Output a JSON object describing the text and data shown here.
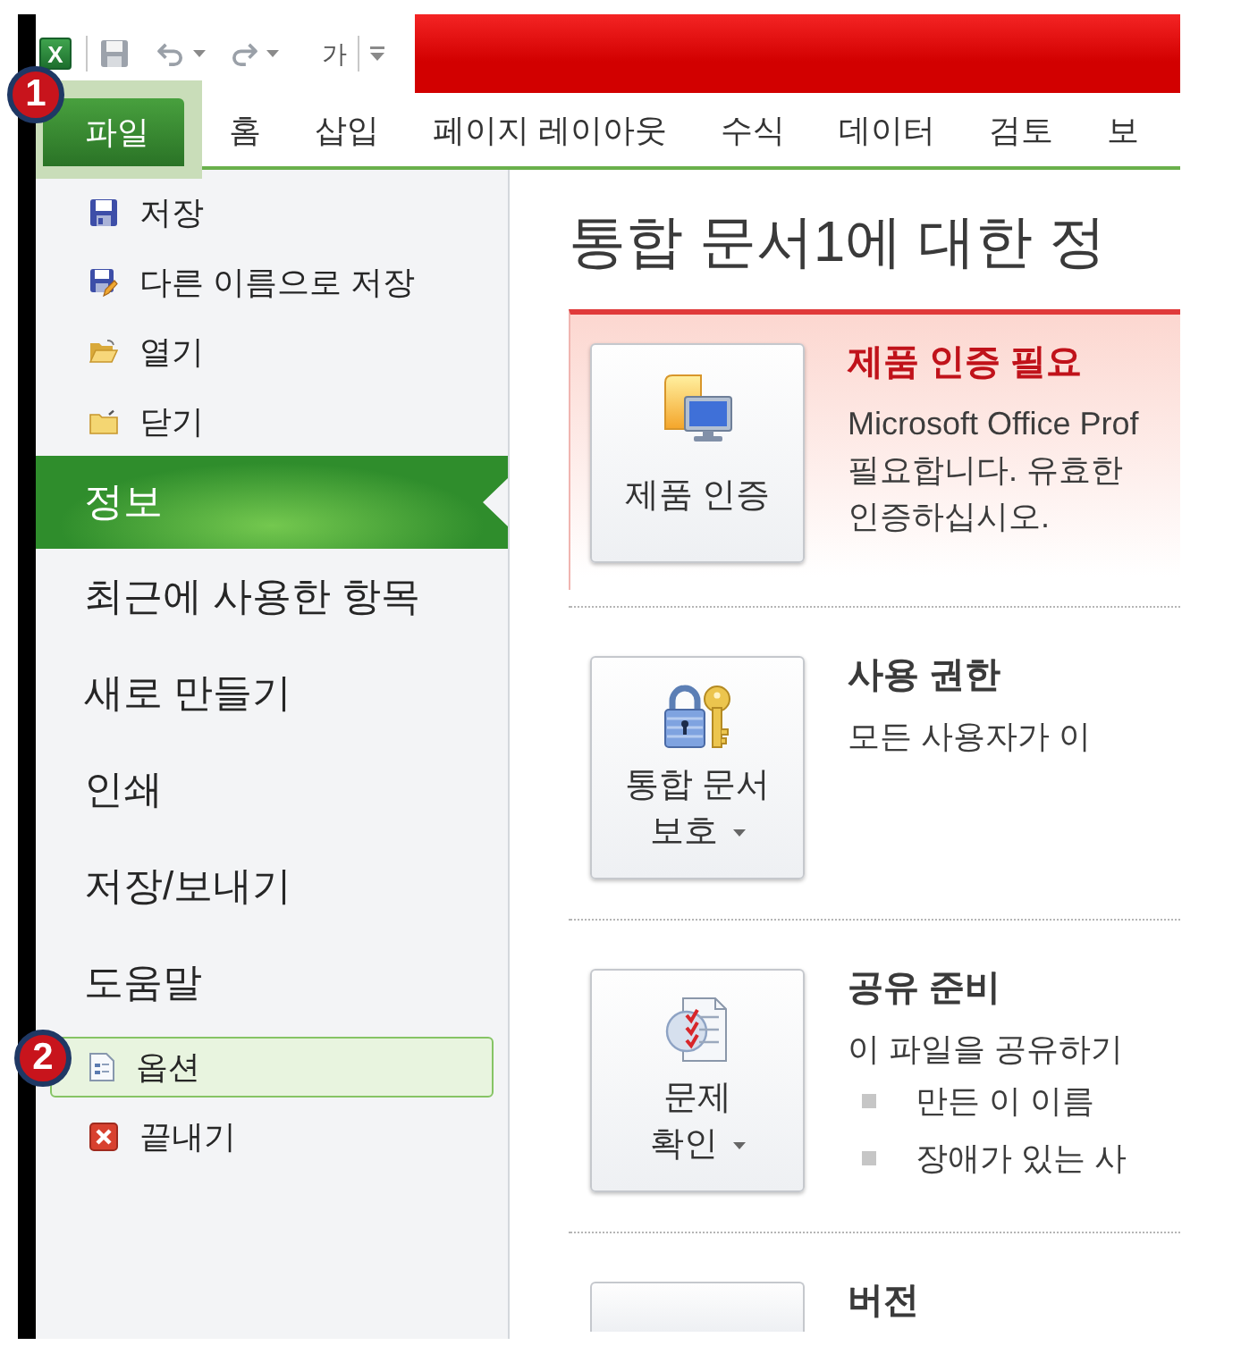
{
  "quick_access_toolbar": {
    "app_logo": "X",
    "font_button": "가"
  },
  "ribbon_tabs": [
    {
      "label": "파일",
      "kind": "file",
      "selected": true,
      "highlighted": true,
      "callout": "1"
    },
    {
      "label": "홈",
      "kind": "tab",
      "selected": false,
      "highlighted": false
    },
    {
      "label": "삽입",
      "kind": "tab",
      "selected": false,
      "highlighted": false
    },
    {
      "label": "페이지 레이아웃",
      "kind": "tab",
      "selected": false,
      "highlighted": false
    },
    {
      "label": "수식",
      "kind": "tab",
      "selected": false,
      "highlighted": false
    },
    {
      "label": "데이터",
      "kind": "tab",
      "selected": false,
      "highlighted": false
    },
    {
      "label": "검토",
      "kind": "tab",
      "selected": false,
      "highlighted": false
    },
    {
      "label": "보",
      "kind": "tab",
      "selected": false,
      "highlighted": false
    }
  ],
  "backstage_menu": [
    {
      "label": "저장",
      "kind": "command",
      "selected": false,
      "highlighted": false
    },
    {
      "label": "다른 이름으로 저장",
      "kind": "command",
      "selected": false,
      "highlighted": false
    },
    {
      "label": "열기",
      "kind": "command",
      "selected": false,
      "highlighted": false
    },
    {
      "label": "닫기",
      "kind": "command",
      "selected": false,
      "highlighted": false
    },
    {
      "label": "정보",
      "kind": "page",
      "selected": true,
      "highlighted": false
    },
    {
      "label": "최근에 사용한 항목",
      "kind": "page",
      "selected": false,
      "highlighted": false
    },
    {
      "label": "새로 만들기",
      "kind": "page",
      "selected": false,
      "highlighted": false
    },
    {
      "label": "인쇄",
      "kind": "page",
      "selected": false,
      "highlighted": false
    },
    {
      "label": "저장/보내기",
      "kind": "page",
      "selected": false,
      "highlighted": false
    },
    {
      "label": "도움말",
      "kind": "page",
      "selected": false,
      "highlighted": false
    },
    {
      "label": "옵션",
      "kind": "command",
      "selected": false,
      "highlighted": true,
      "callout": "2"
    },
    {
      "label": "끝내기",
      "kind": "command",
      "selected": false,
      "highlighted": false
    }
  ],
  "info_page": {
    "title": "통합 문서1에 대한 정",
    "sections": [
      {
        "kind": "alert",
        "button": {
          "label_lines": [
            "제품 인증"
          ]
        },
        "heading": "제품 인증 필요",
        "lines": [
          "Microsoft Office Prof",
          "필요합니다. 유효한",
          "인증하십시오."
        ]
      },
      {
        "kind": "info",
        "button": {
          "label_lines": [
            "통합 문서",
            "보호"
          ],
          "dropdown": true
        },
        "heading": "사용 권한",
        "lines": [
          "모든 사용자가 이"
        ]
      },
      {
        "kind": "info",
        "button": {
          "label_lines": [
            "문제",
            "확인"
          ],
          "dropdown": true
        },
        "heading": "공유 준비",
        "lines": [
          "이 파일을 공유하기"
        ],
        "bullets": [
          "만든 이 이름",
          "장애가 있는 사"
        ]
      },
      {
        "kind": "info",
        "heading": "버전"
      }
    ]
  }
}
